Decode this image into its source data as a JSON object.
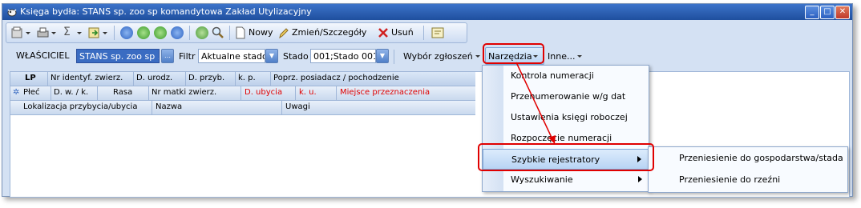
{
  "window": {
    "title": "Księga bydła: STANS sp. zoo sp komandytowa Zakład Utylizacyjny",
    "controls": [
      "_",
      "□",
      "✕"
    ]
  },
  "toolbar": {
    "new_label": "Nowy",
    "edit_label": "Zmień/Szczegóły",
    "delete_label": "Usuń",
    "sum_symbol": "Σ"
  },
  "filterbar": {
    "owner_label": "WŁAŚCICIEL",
    "owner_value": "STANS sp. zoo sp ...",
    "filter_label": "Filtr",
    "filter_value": "Aktualne stado",
    "stado_label": "Stado",
    "stado_value": "001;Stado 001",
    "wybor_label": "Wybór zgłoszeń",
    "narzedzia_label": "Narzędzia",
    "inne_label": "Inne..."
  },
  "grid": {
    "row1": [
      "LP",
      "Nr identyf. zwierz.",
      "D. urodz.",
      "D. przyb.",
      "k. p.",
      "Poprz. posiadacz / pochodzenie"
    ],
    "row2_marker": "✲",
    "row2": [
      "Płeć",
      "D. w. / k.",
      "Rasa",
      "Nr matki zwierz.",
      "D. ubycia",
      "k. u.",
      "Miejsce przeznaczenia"
    ],
    "row3": [
      "Lokalizacja przybycia/ubycia",
      "Nazwa",
      "Uwagi"
    ],
    "colors": {
      "highlight": "#e00000"
    }
  },
  "menu": {
    "items": [
      {
        "label": "Kontrola numeracji"
      },
      {
        "label": "Przenumerowanie w/g dat"
      },
      {
        "label": "Ustawienia księgi roboczej"
      },
      {
        "label": "Rozpoczęcie numeracji"
      },
      {
        "label": "Szybkie rejestratory"
      },
      {
        "label": "Wyszukiwanie"
      }
    ]
  },
  "submenu": {
    "items": [
      {
        "label": "Przeniesienie do gospodarstwa/stada"
      },
      {
        "label": "Przeniesienie do rzeźni"
      }
    ]
  }
}
